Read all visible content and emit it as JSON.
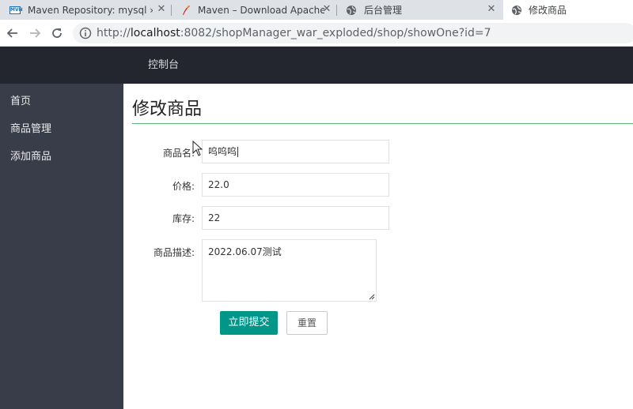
{
  "browser": {
    "tabs": [
      {
        "title": "Maven Repository: mysql » mysql",
        "icon": "mvn-favicon"
      },
      {
        "title": "Maven – Download Apache Maven",
        "icon": "apache-feather-icon"
      },
      {
        "title": "后台管理",
        "icon": "globe-icon"
      },
      {
        "title": "修改商品",
        "icon": "globe-icon",
        "active": true
      }
    ],
    "url_host": "localhost",
    "url_scheme": "http://",
    "url_rest": ":8082/shopManager_war_exploded/shop/showOne?id=7"
  },
  "header": {
    "title": "控制台"
  },
  "sidebar": {
    "items": [
      {
        "label": "首页"
      },
      {
        "label": "商品管理"
      },
      {
        "label": "添加商品"
      }
    ]
  },
  "main": {
    "title": "修改商品",
    "form": {
      "name_label": "商品名:",
      "name_value": "呜呜呜",
      "price_label": "价格:",
      "price_value": "22.0",
      "stock_label": "库存:",
      "stock_value": "22",
      "desc_label": "商品描述:",
      "desc_value": "2022.06.07测试",
      "submit_label": "立即提交",
      "reset_label": "重置"
    }
  },
  "colors": {
    "header_bg": "#23262e",
    "sidebar_bg": "#393d49",
    "accent": "#009688",
    "title_rule": "#5fb878"
  }
}
